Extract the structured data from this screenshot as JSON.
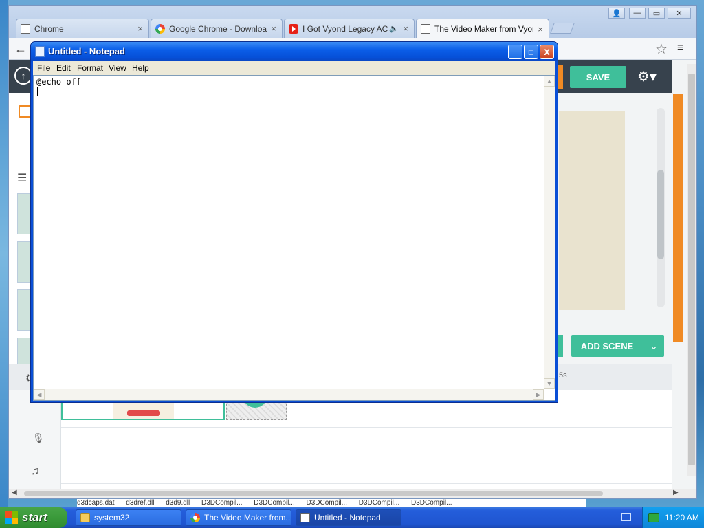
{
  "browser": {
    "tabs": [
      {
        "title": "Chrome",
        "icon": "document-icon",
        "active": false
      },
      {
        "title": "Google Chrome - Download t",
        "icon": "google-icon",
        "active": false
      },
      {
        "title": "I Got Vyond Legacy ACS",
        "icon": "youtube-icon",
        "active": false,
        "audio": "🔈"
      },
      {
        "title": "The Video Maker from Vyond",
        "icon": "document-icon",
        "active": true
      }
    ],
    "close_glyph": "×",
    "window_controls": {
      "user": "👤",
      "minimize": "—",
      "maximize": "▭",
      "close": "✕"
    },
    "back_glyph": "←",
    "star_glyph": "☆",
    "menu_glyph": "≡"
  },
  "app": {
    "save_label": "SAVE",
    "settings_glyph": "⚙▾",
    "upload_glyph": "↑",
    "add_scene_label": "ADD SCENE",
    "add_scene_caret": "⌄",
    "time_label": "5s",
    "plus_glyph": "+",
    "mic_glyph": "🎙",
    "music_glyph": "♫",
    "list_glyph": "☰",
    "gear_glyph": "⚙"
  },
  "notepad": {
    "title": "Untitled - Notepad",
    "menu": [
      "File",
      "Edit",
      "Format",
      "View",
      "Help"
    ],
    "content": "@echo off",
    "minimize": "_",
    "maximize": "□",
    "close": "X",
    "arrow_up": "▲",
    "arrow_down": "▼",
    "arrow_left": "◀",
    "arrow_right": "▶"
  },
  "file_strip": [
    "d3dcaps.dat",
    "d3dref.dll",
    "d3d9.dll",
    "D3DCompil...",
    "D3DCompil...",
    "D3DCompil...",
    "D3DCompil...",
    "D3DCompil..."
  ],
  "taskbar": {
    "start_label": "start",
    "tasks": [
      {
        "label": "system32",
        "icon": "folder-icon"
      },
      {
        "label": "The Video Maker from...",
        "icon": "chrome-icon"
      },
      {
        "label": "Untitled - Notepad",
        "icon": "notepad-icon",
        "active": true
      }
    ],
    "clock": "11:20 AM"
  },
  "colors": {
    "accent_green": "#3fbf9a",
    "accent_orange": "#f08a24",
    "xp_blue": "#0a4fd6"
  }
}
